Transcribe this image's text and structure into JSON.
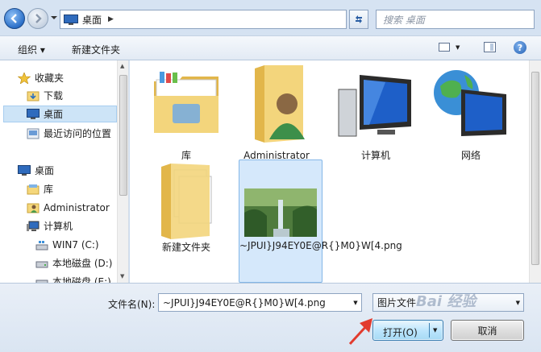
{
  "address": {
    "location": "桌面",
    "search_placeholder": "搜索 桌面"
  },
  "toolbar": {
    "organize": "组织 ▾",
    "new_folder": "新建文件夹"
  },
  "nav": {
    "favorites": "收藏夹",
    "downloads": "下载",
    "desktop": "桌面",
    "recent": "最近访问的位置",
    "desktop_root": "桌面",
    "libraries": "库",
    "user": "Administrator",
    "computer": "计算机",
    "drive_c": "WIN7 (C:)",
    "drive_d": "本地磁盘 (D:)",
    "drive_e": "本地磁盘 (E:)"
  },
  "items": [
    {
      "name": "库"
    },
    {
      "name": "Administrator"
    },
    {
      "name": "计算机"
    },
    {
      "name": "网络"
    },
    {
      "name": "新建文件夹"
    },
    {
      "name": "~JPUI}J94EY0E@R{}M0}W[4.png"
    }
  ],
  "bottom": {
    "filename_label": "文件名(N):",
    "filename_value": "~JPUI}J94EY0E@R{}M0}W[4.png",
    "filetype": "图片文件",
    "open_label": "打开(O)",
    "cancel_label": "取消"
  },
  "watermark": "Bai 经验"
}
